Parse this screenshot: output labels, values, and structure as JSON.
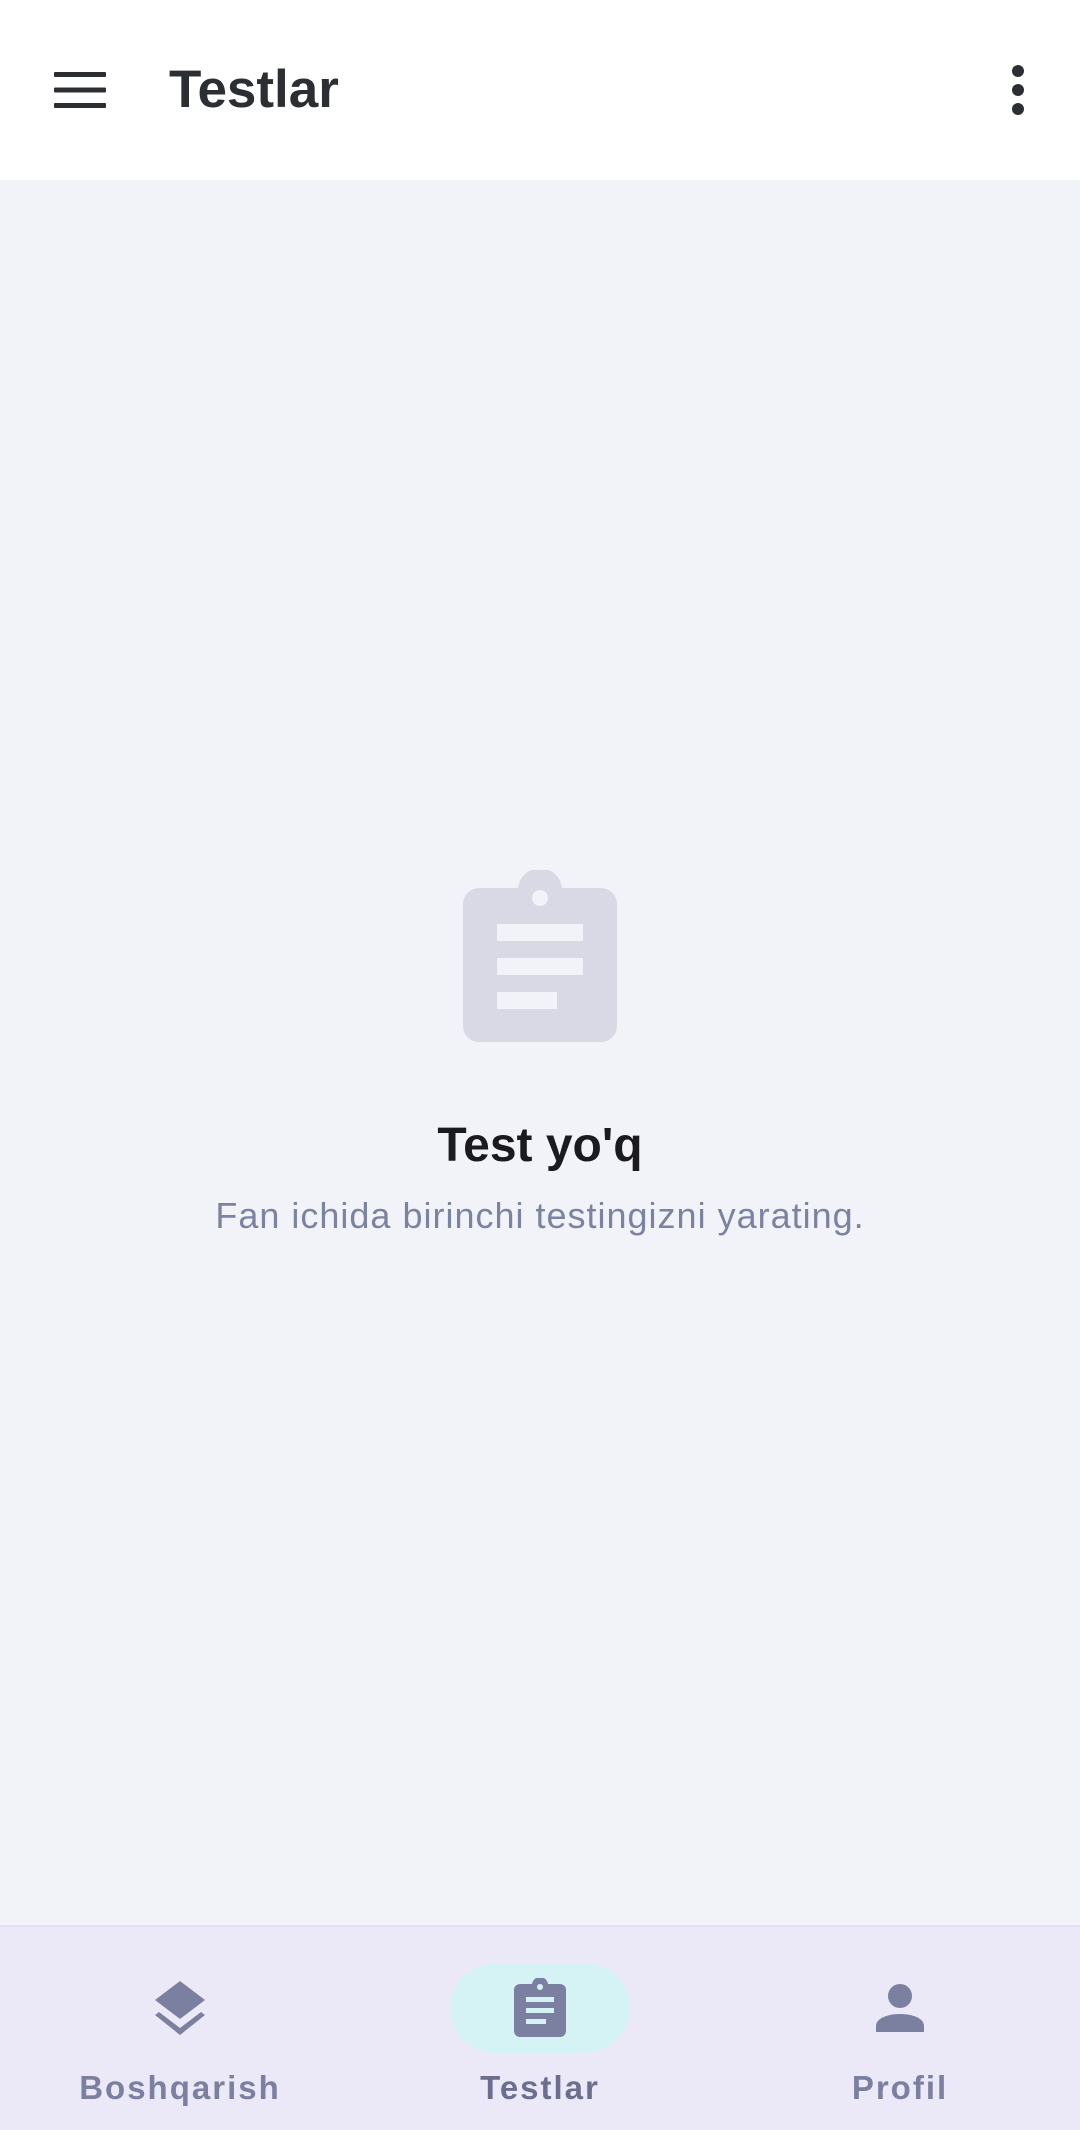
{
  "app": {
    "title": "Testlar"
  },
  "icons": {
    "menu": "hamburger-menu-icon",
    "overflow": "more-vert-icon",
    "empty_state": "clipboard-icon",
    "nav_dashboard": "layers-icon",
    "nav_tests": "clipboard-icon",
    "nav_profile": "person-icon"
  },
  "empty_state": {
    "title": "Test yo'q",
    "subtitle": "Fan ichida birinchi testingizni yarating."
  },
  "bottom_nav": {
    "items": [
      {
        "label": "Boshqarish",
        "active": false
      },
      {
        "label": "Testlar",
        "active": true
      },
      {
        "label": "Profil",
        "active": false
      }
    ]
  },
  "colors": {
    "background": "#f2f3f8",
    "appbar": "#ffffff",
    "nav_background": "#ebe8f8",
    "nav_active_indicator": "#d5f3f4",
    "icon_muted": "#7c80a0",
    "empty_icon": "#d8d9e5"
  }
}
